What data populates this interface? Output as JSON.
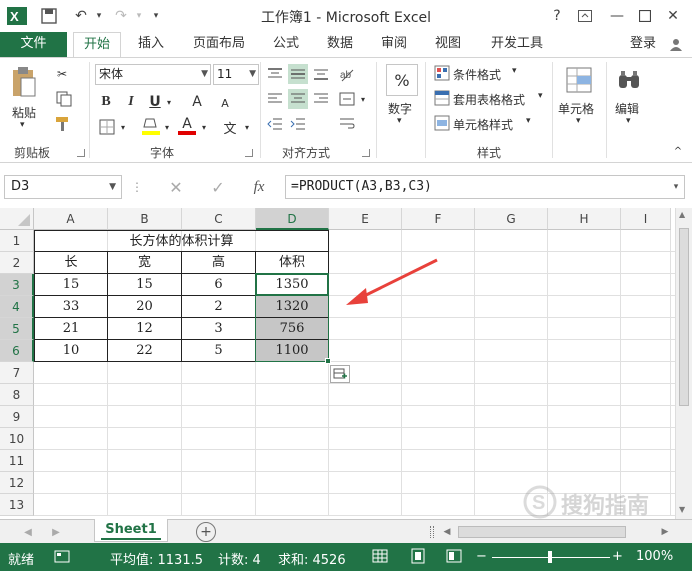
{
  "app": {
    "title": "工作簿1 - Microsoft Excel",
    "help": "?",
    "login": "登录",
    "icons": [
      "excel-logo-icon",
      "save-icon",
      "undo-icon",
      "redo-icon",
      "customize-qat-icon",
      "help-icon",
      "ribbon-display-icon",
      "minimize-icon",
      "restore-icon",
      "close-icon"
    ]
  },
  "tabs": [
    "文件",
    "开始",
    "插入",
    "页面布局",
    "公式",
    "数据",
    "审阅",
    "视图",
    "开发工具"
  ],
  "ribbon": {
    "clipboard": {
      "paste": "粘贴",
      "label": "剪贴板"
    },
    "font": {
      "name": "宋体",
      "size": "11",
      "bold": "B",
      "italic": "I",
      "underline": "U",
      "grow": "A",
      "shrink": "A",
      "font_color": "A",
      "phonetic": "文",
      "label": "字体"
    },
    "alignment": {
      "label": "对齐方式"
    },
    "number": {
      "symbol": "%",
      "label": "数字"
    },
    "styles": {
      "conditional": "条件格式",
      "table": "套用表格格式",
      "cell": "单元格样式",
      "label": "样式"
    },
    "cells": {
      "label": "单元格"
    },
    "editing": {
      "label": "编辑"
    }
  },
  "formula_bar": {
    "name_box": "D3",
    "fx": "fx",
    "formula": "=PRODUCT(A3,B3,C3)"
  },
  "grid": {
    "columns": [
      "A",
      "B",
      "C",
      "D",
      "E",
      "F",
      "G",
      "H",
      "I"
    ],
    "rows": [
      "1",
      "2",
      "3",
      "4",
      "5",
      "6",
      "7",
      "8",
      "9",
      "10",
      "11",
      "12",
      "13"
    ],
    "title": "长方体的体积计算",
    "headers": [
      "长",
      "宽",
      "高",
      "体积"
    ],
    "data": [
      [
        "15",
        "15",
        "6",
        "1350"
      ],
      [
        "33",
        "20",
        "2",
        "1320"
      ],
      [
        "21",
        "12",
        "3",
        "756"
      ],
      [
        "10",
        "22",
        "5",
        "1100"
      ]
    ]
  },
  "sheet_tabs": {
    "active": "Sheet1",
    "add": "+"
  },
  "status_bar": {
    "mode": "就绪",
    "average": "平均值: 1131.5",
    "count": "计数: 4",
    "sum": "求和: 4526",
    "zoom": "100%"
  },
  "colors": {
    "accent": "#217346",
    "arrow": "#e8413b",
    "selection": "#c6c6c6"
  },
  "watermark": "搜狗指南"
}
